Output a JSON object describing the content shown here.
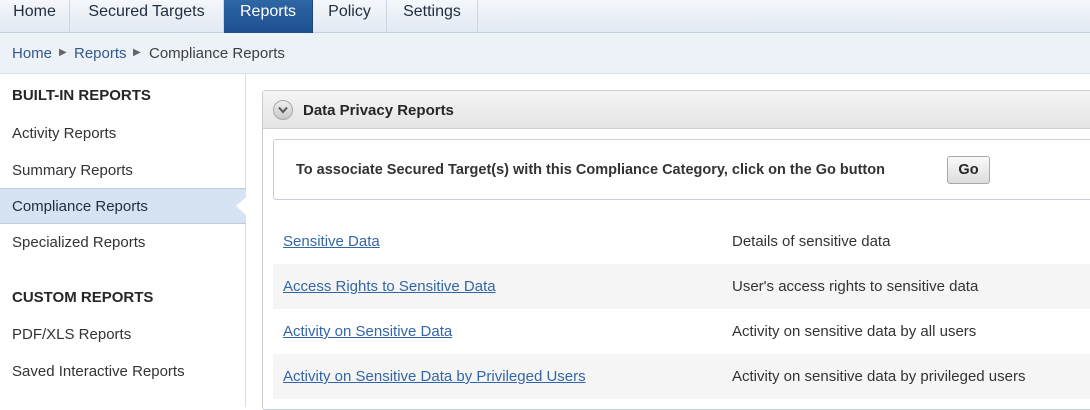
{
  "tabs": [
    {
      "label": "Home",
      "active": false
    },
    {
      "label": "Secured Targets",
      "active": false
    },
    {
      "label": "Reports",
      "active": true
    },
    {
      "label": "Policy",
      "active": false
    },
    {
      "label": "Settings",
      "active": false
    }
  ],
  "breadcrumb": {
    "items": [
      "Home",
      "Reports",
      "Compliance Reports"
    ]
  },
  "sidebar": {
    "builtin_heading": "BUILT-IN REPORTS",
    "builtin_items": [
      {
        "label": "Activity Reports"
      },
      {
        "label": "Summary Reports"
      },
      {
        "label": "Compliance Reports"
      },
      {
        "label": "Specialized Reports"
      }
    ],
    "custom_heading": "CUSTOM REPORTS",
    "custom_items": [
      {
        "label": "PDF/XLS Reports"
      },
      {
        "label": "Saved Interactive Reports"
      }
    ]
  },
  "panel": {
    "title": "Data Privacy Reports",
    "associate_text": "To associate Secured Target(s) with this Compliance Category, click on the Go button",
    "go_label": "Go",
    "reports": [
      {
        "name": "Sensitive Data",
        "description": "Details of sensitive data"
      },
      {
        "name": "Access Rights to Sensitive Data",
        "description": "User's access rights to sensitive data"
      },
      {
        "name": "Activity on Sensitive Data",
        "description": "Activity on sensitive data by all users"
      },
      {
        "name": "Activity on Sensitive Data by Privileged Users",
        "description": "Activity on sensitive data by privileged users"
      }
    ]
  },
  "colors": {
    "active_tab": "#1d4f8f",
    "link": "#3366a8",
    "selected_sidebar": "#d5e3f2"
  }
}
